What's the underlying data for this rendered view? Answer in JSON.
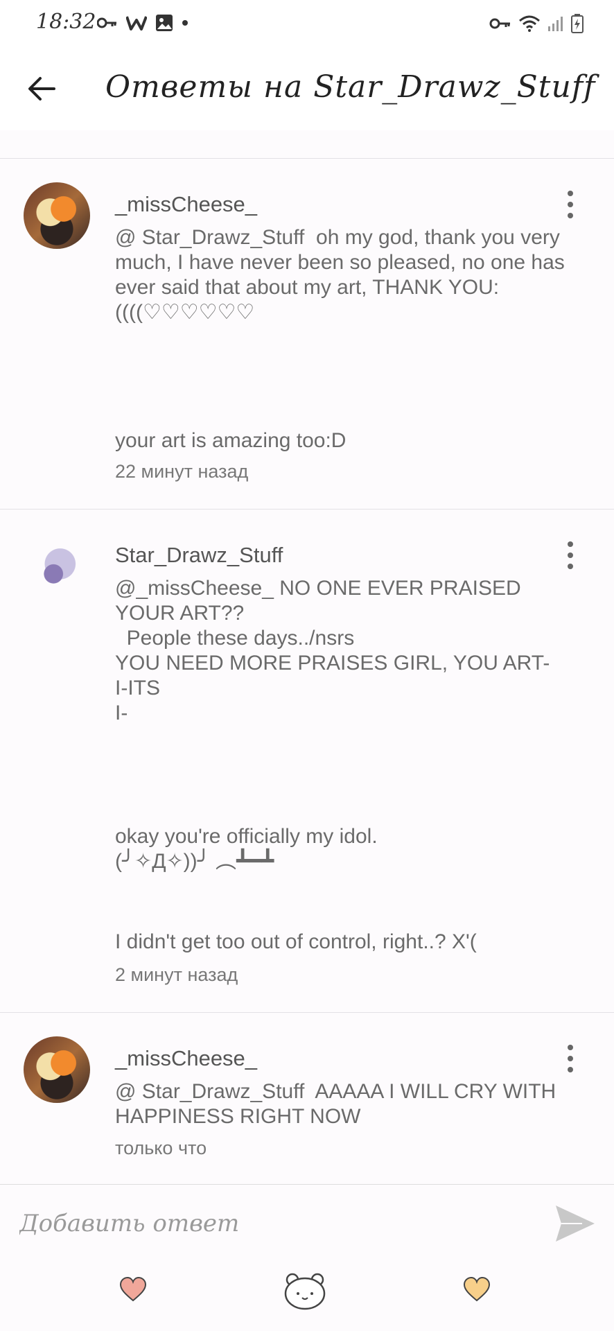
{
  "status_bar": {
    "time": "18:32",
    "left_icons": [
      "key-icon",
      "w-icon",
      "image-icon",
      "dot-icon"
    ],
    "right_icons": [
      "vpn-key-icon",
      "wifi-icon",
      "signal-icon",
      "battery-icon"
    ]
  },
  "header": {
    "title": "Ответы на Star_Drawz_Stuff"
  },
  "comments": [
    {
      "username": "_missCheese_",
      "body_main": "@ Star_Drawz_Stuff  oh my god, thank you very much, I have never been so pleased, no one has ever said that about my art, THANK YOU:((((♡♡♡♡♡♡",
      "body_extra": "your art is amazing too:D",
      "time": "22 минут назад"
    },
    {
      "username": "Star_Drawz_Stuff",
      "body_main": "@_missCheese_ NO ONE EVER PRAISED YOUR ART??\n  People these days../nsrs\nYOU NEED MORE PRAISES GIRL, YOU ART-\nI-ITS\nI-",
      "body_extra": "okay you're officially my idol.\n(╯✧Д✧))╯ ︵┻━┻",
      "body_extra2": "I didn't get too out of control, right..? X'(",
      "time": "2 минут назад"
    },
    {
      "username": "_missCheese_",
      "body_main": "@ Star_Drawz_Stuff  AAAAA I WILL CRY WITH HAPPINESS RIGHT NOW",
      "time": "только что"
    }
  ],
  "reply": {
    "placeholder": "Добавить ответ"
  },
  "bottom_bar": {
    "icons": [
      "heart-icon",
      "bear-icon",
      "heart-icon"
    ]
  },
  "colors": {
    "heart_left": "#f0a79a",
    "heart_right": "#f7cf8a",
    "send": "#c8c8c8"
  }
}
